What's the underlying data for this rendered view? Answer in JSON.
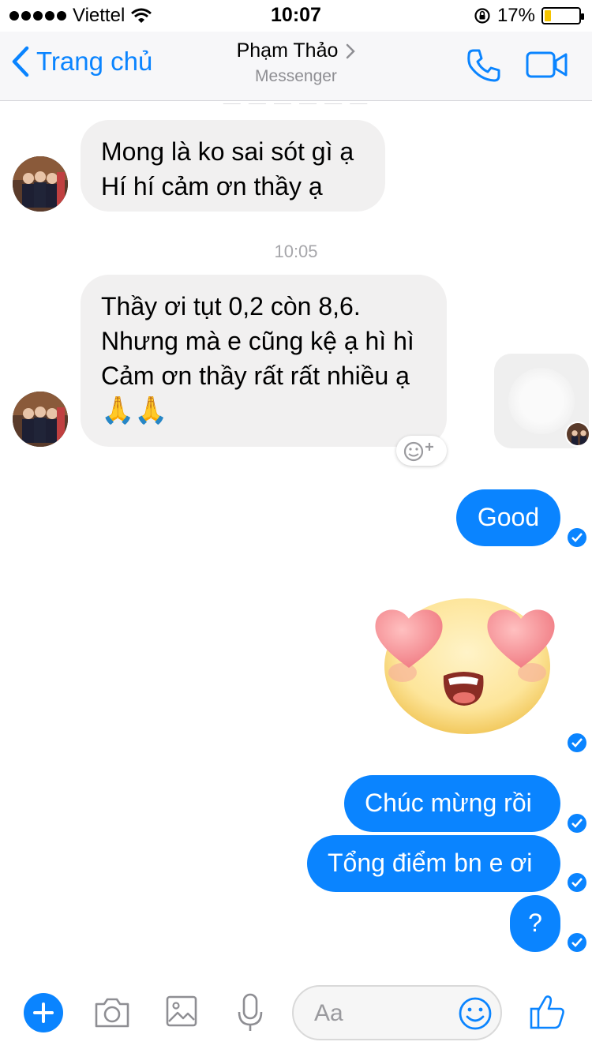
{
  "status_bar": {
    "carrier": "Viettel",
    "time": "10:07",
    "battery": "17%"
  },
  "nav": {
    "back_label": "Trang chủ",
    "title": "Phạm Thảo",
    "subtitle": "Messenger"
  },
  "messages": {
    "incoming_1": [
      "Mong là ko sai sót gì ạ",
      "Hí hí cảm ơn thầy ạ"
    ],
    "timestamp_1": "10:05",
    "incoming_2": [
      "Thầy ơi tụt 0,2 còn 8,6.",
      "Nhưng mà e cũng kệ ạ hì hì",
      "Cảm ơn thầy rất rất nhiều ạ",
      "🙏🙏"
    ],
    "outgoing_1": "Good",
    "outgoing_2": "Chúc mừng rồi",
    "outgoing_3": "Tổng điểm bn e ơi",
    "outgoing_4": "?"
  },
  "composer": {
    "placeholder": "Aa"
  },
  "colors": {
    "accent": "#0a84ff",
    "incoming_bubble": "#f1f0f0",
    "muted_text": "#8e8e93"
  }
}
